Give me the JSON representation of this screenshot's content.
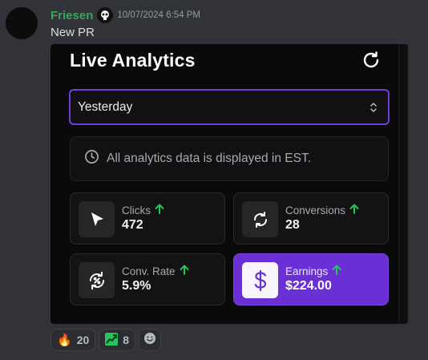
{
  "message": {
    "username": "Friesen",
    "timestamp": "10/07/2024 6:54 PM",
    "text": "New PR"
  },
  "embed": {
    "title": "Live Analytics",
    "select": {
      "value": "Yesterday"
    },
    "info": "All analytics data is displayed in EST.",
    "cards": [
      {
        "label": "Clicks",
        "value": "472",
        "icon": "cursor-icon"
      },
      {
        "label": "Conversions",
        "value": "28",
        "icon": "cycle-icon"
      },
      {
        "label": "Conv. Rate",
        "value": "5.9%",
        "icon": "percent-cycle-icon"
      },
      {
        "label": "Earnings",
        "value": "$224.00",
        "icon": "dollar-icon"
      }
    ]
  },
  "reactions": [
    {
      "emoji": "🔥",
      "count": "20"
    },
    {
      "emoji": "chart-up",
      "count": "8"
    }
  ],
  "colors": {
    "accent": "#6b2fd6",
    "up": "#22c55e",
    "username": "#3ba55c"
  }
}
